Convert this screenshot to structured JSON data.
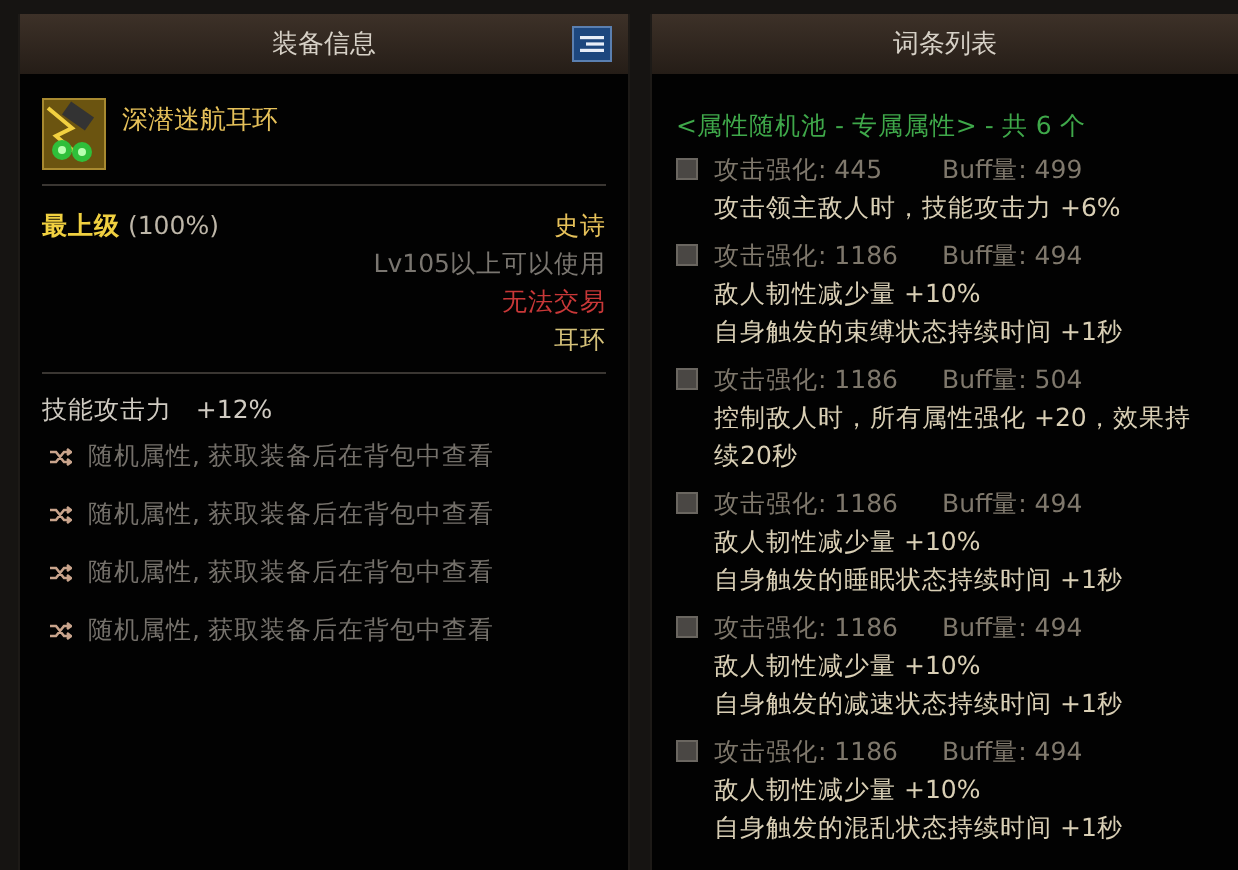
{
  "equipment_panel": {
    "title": "装备信息",
    "item_name": "深潜迷航耳环",
    "grade": "最上级",
    "grade_percent": "(100%)",
    "rarity": "史诗",
    "requirement": "Lv105以上可以使用",
    "trade": "无法交易",
    "slot": "耳环",
    "base_stat": {
      "name": "技能攻击力",
      "value": "+12%"
    },
    "random_stats": [
      "随机属性, 获取装备后在背包中查看",
      "随机属性, 获取装备后在背包中查看",
      "随机属性, 获取装备后在背包中查看",
      "随机属性, 获取装备后在背包中查看"
    ]
  },
  "affix_panel": {
    "title": "词条列表",
    "pool_label": "<属性随机池 - 专属属性> - 共 6 个",
    "entries": [
      {
        "checked": false,
        "attack": "攻击强化: 445",
        "buff": "Buff量: 499",
        "effects": [
          "攻击领主敌人时，技能攻击力 +6%"
        ]
      },
      {
        "checked": false,
        "attack": "攻击强化: 1186",
        "buff": "Buff量: 494",
        "effects": [
          "敌人韧性减少量 +10%",
          "自身触发的束缚状态持续时间 +1秒"
        ]
      },
      {
        "checked": false,
        "attack": "攻击强化: 1186",
        "buff": "Buff量: 504",
        "effects": [
          "控制敌人时，所有属性强化 +20，效果持续20秒"
        ]
      },
      {
        "checked": false,
        "attack": "攻击强化: 1186",
        "buff": "Buff量: 494",
        "effects": [
          "敌人韧性减少量 +10%",
          "自身触发的睡眠状态持续时间 +1秒"
        ]
      },
      {
        "checked": false,
        "attack": "攻击强化: 1186",
        "buff": "Buff量: 494",
        "effects": [
          "敌人韧性减少量 +10%",
          "自身触发的减速状态持续时间 +1秒"
        ]
      },
      {
        "checked": false,
        "attack": "攻击强化: 1186",
        "buff": "Buff量: 494",
        "effects": [
          "敌人韧性减少量 +10%",
          "自身触发的混乱状态持续时间 +1秒"
        ]
      }
    ]
  }
}
